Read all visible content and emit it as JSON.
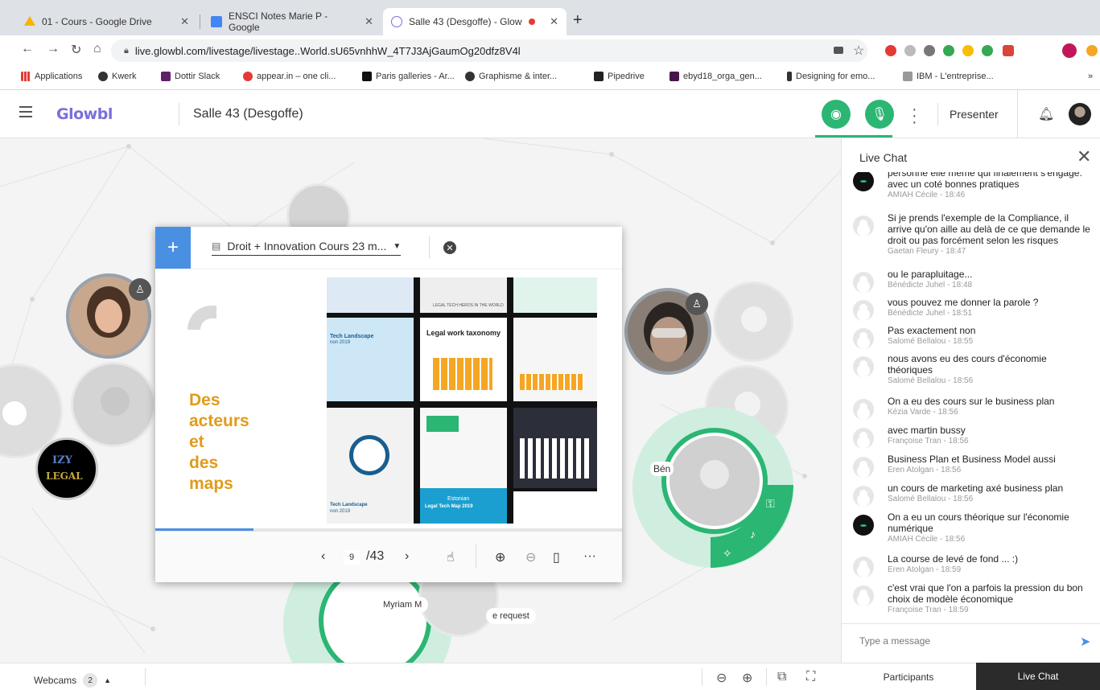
{
  "browser": {
    "tabs": [
      {
        "title": "01 - Cours - Google Drive",
        "color": "#f4b400"
      },
      {
        "title": "ENSCI Notes Marie P - Google",
        "color": "#4285f4"
      },
      {
        "title": "Salle 43 (Desgoffe) - Glow",
        "color": "#7b6fd8"
      }
    ],
    "url": "live.glowbl.com/livestage/livestage..World.sU65vnhhW_4T7J3AjGaumOg20dfz8V4l",
    "bookmarks": [
      "Applications",
      "Kwerk",
      "Dottir Slack",
      "appear.in – one cli...",
      "Paris galleries - Ar...",
      "Graphisme & inter...",
      "Pipedrive",
      "ebyd18_orga_gen...",
      "Designing for emo...",
      "IBM - L'entreprise..."
    ]
  },
  "app": {
    "logo": "Glowbl",
    "room": "Salle 43 (Desgoffe)",
    "presenter_label": "Presenter",
    "accent": "#2bb673"
  },
  "document": {
    "title": "Droit + Innovation Cours 23 m...",
    "slide_title_lines": [
      "Des",
      "acteurs",
      "et",
      "des",
      "maps"
    ],
    "current_page": "9",
    "total_pages": "/43",
    "progress": 0.21,
    "mosaic_labels": {
      "legal_tech": "LEGAL TECH HEROS IN THE WORLD",
      "taxonomy": "Legal work taxonomy",
      "landscape": "Tech Landscape",
      "landscape_year": "non 2019",
      "landscape2": "Tech Landscape",
      "landscape2_year": "non 2019",
      "estonian": "Estonian",
      "estonian_sub": "Legal Tech Map 2019"
    }
  },
  "stage": {
    "labels": {
      "ben": "Bén",
      "myriam": "Myriam M",
      "request": "e request"
    },
    "izy_logo_top": "IZY",
    "izy_logo_bottom": "LEGAL"
  },
  "chat": {
    "title": "Live Chat",
    "placeholder": "Type a message",
    "messages": [
      {
        "text": "personne elle même qui finalement s'engage. avec un coté bonnes pratiques",
        "meta": "AMIAH Cécile - 18:46",
        "avatar": "dark"
      },
      {
        "text": "Si je prends l'exemple de la Compliance, il arrive qu'on aille au delà de ce que demande le droit ou pas forcément selon les risques",
        "meta": "Gaetan Fleury - 18:47",
        "avatar": "default"
      },
      {
        "text": "ou le parapluitage...",
        "meta": "Bénédicte Juhel - 18:48",
        "avatar": "default"
      },
      {
        "text": "vous pouvez me donner la parole ?",
        "meta": "Bénédicte Juhel - 18:51",
        "avatar": "default"
      },
      {
        "text": "Pas exactement non",
        "meta": "Salomé Bellalou - 18:55",
        "avatar": "default"
      },
      {
        "text": "nous avons eu des cours d'économie théoriques",
        "meta": "Salomé Bellalou - 18:56",
        "avatar": "default"
      },
      {
        "text": "On a eu des cours sur le business plan",
        "meta": "Kézia Varde - 18:56",
        "avatar": "default"
      },
      {
        "text": "avec martin bussy",
        "meta": "Françoise Tran - 18:56",
        "avatar": "default"
      },
      {
        "text": "Business Plan et Business Model aussi",
        "meta": "Eren Atolgan - 18:56",
        "avatar": "default"
      },
      {
        "text": "un cours de marketing axé business plan",
        "meta": "Salomé Bellalou - 18:56",
        "avatar": "default"
      },
      {
        "text": "On a eu un cours théorique sur l'économie numérique",
        "meta": "AMIAH Cécile - 18:56",
        "avatar": "dark"
      },
      {
        "text": "La course de levé de fond ... :)",
        "meta": "Eren Atolgan - 18:59",
        "avatar": "default"
      },
      {
        "text": "c'est vrai que l'on a parfois la pression du bon choix de modèle économique",
        "meta": "Françoise Tran - 18:59",
        "avatar": "default"
      }
    ]
  },
  "bottom": {
    "webcams_label": "Webcams",
    "webcams_count": "2",
    "tab_participants": "Participants",
    "tab_livechat": "Live Chat"
  }
}
